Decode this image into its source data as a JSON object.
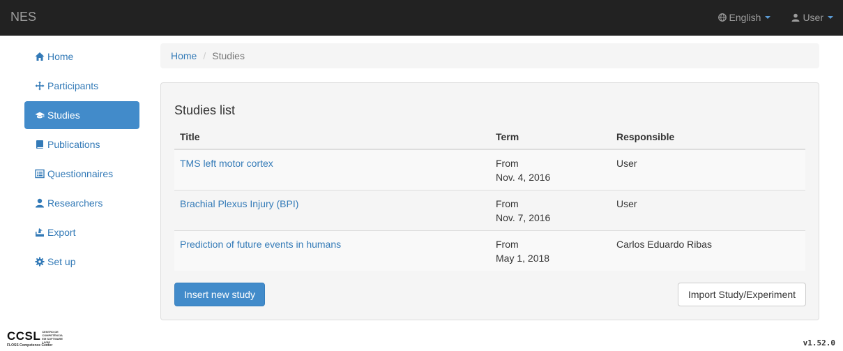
{
  "navbar": {
    "brand": "NES",
    "language": "English",
    "user": "User",
    "accent": "#5b9bd5"
  },
  "sidebar": {
    "items": [
      {
        "label": "Home",
        "icon": "home-icon"
      },
      {
        "label": "Participants",
        "icon": "move-icon"
      },
      {
        "label": "Studies",
        "icon": "education-icon",
        "active": true
      },
      {
        "label": "Publications",
        "icon": "book-icon"
      },
      {
        "label": "Questionnaires",
        "icon": "list-alt-icon"
      },
      {
        "label": "Researchers",
        "icon": "user-icon"
      },
      {
        "label": "Export",
        "icon": "export-icon"
      },
      {
        "label": "Set up",
        "icon": "cog-icon"
      }
    ]
  },
  "breadcrumb": {
    "home": "Home",
    "current": "Studies"
  },
  "panel": {
    "title": "Studies list",
    "columns": [
      "Title",
      "Term",
      "Responsible"
    ],
    "rows": [
      {
        "title": "TMS left motor cortex",
        "term_prefix": "From",
        "term_date": "Nov. 4, 2016",
        "responsible": "User"
      },
      {
        "title": "Brachial Plexus Injury (BPI)",
        "term_prefix": "From",
        "term_date": "Nov. 7, 2016",
        "responsible": "User"
      },
      {
        "title": "Prediction of future events in humans",
        "term_prefix": "From",
        "term_date": "May 1, 2018",
        "responsible": "Carlos Eduardo Ribas"
      }
    ],
    "insert_button": "Insert new study",
    "import_button": "Import Study/Experiment"
  },
  "footer": {
    "logo_text": "CCSL",
    "logo_subtitle": "CENTRO DE COMPETÊNCIA EM SOFTWARE LIVRE",
    "logo_tagline": "FLOSS Competence Center",
    "version": "v1.52.0"
  },
  "colors": {
    "primary": "#428bca",
    "link": "#337ab7",
    "navbar_bg": "#222222"
  }
}
